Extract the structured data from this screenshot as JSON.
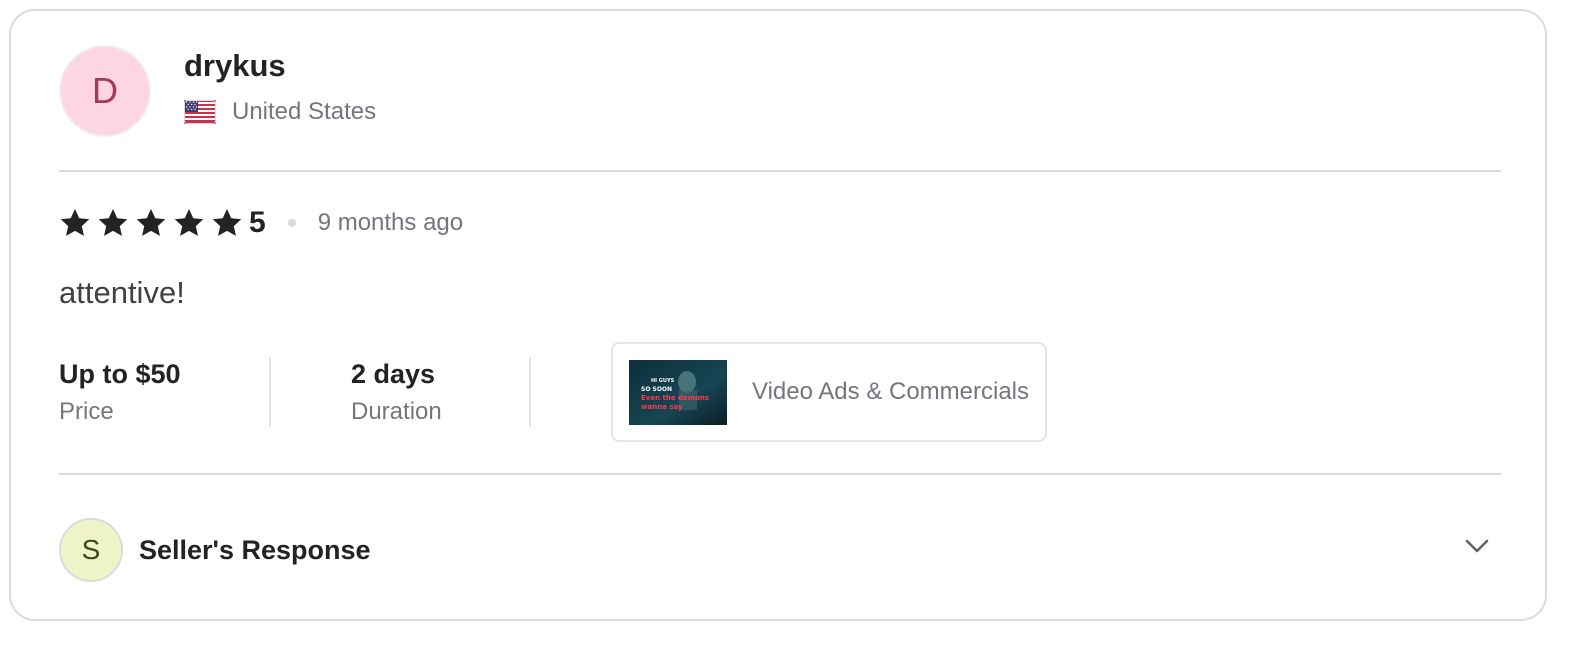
{
  "reviewer": {
    "avatar_initial": "D",
    "username": "drykus",
    "country": "United States",
    "flag_icon": "us-flag-icon"
  },
  "rating": {
    "stars": 5,
    "value": "5",
    "time_ago": "9 months ago"
  },
  "review": {
    "text": "attentive!"
  },
  "meta": {
    "price_value": "Up to $50",
    "price_label": "Price",
    "duration_value": "2 days",
    "duration_label": "Duration"
  },
  "gig": {
    "title": "Video Ads & Commercials",
    "thumbnail_lines": [
      "HI GUYS",
      "SO SOON",
      "Even the demons",
      "wanna say"
    ]
  },
  "seller_response": {
    "avatar_initial": "S",
    "title": "Seller's Response",
    "toggle_icon": "chevron-down-icon"
  },
  "colors": {
    "star": "#222325",
    "reviewer_avatar_bg": "#fdd5e3",
    "reviewer_avatar_text": "#a23b5a",
    "seller_avatar_bg": "#eef4c8",
    "seller_avatar_text": "#3b4a13",
    "muted_text": "#74767e",
    "border": "#dadbdd"
  }
}
